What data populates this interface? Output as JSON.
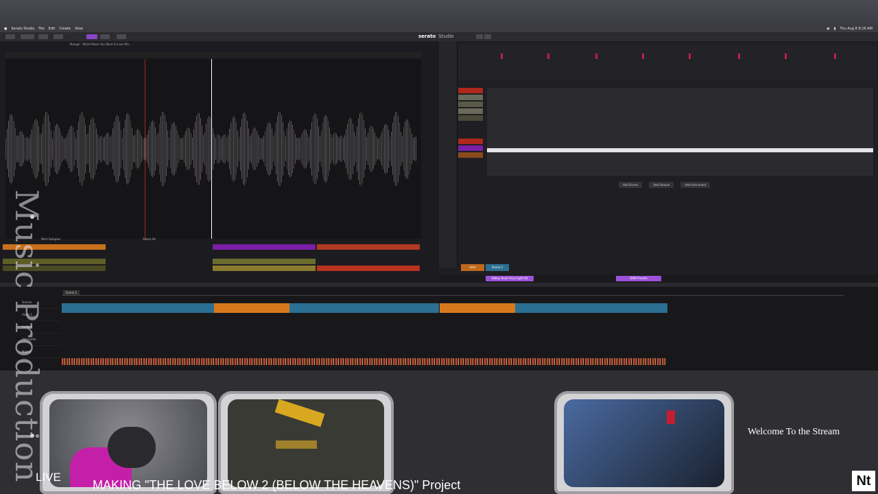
{
  "menubar": {
    "app_name": "Serato Studio",
    "items": [
      "File",
      "Edit",
      "Create",
      "View"
    ],
    "clock": "Thu Aug 8  8:16 AM"
  },
  "toolbar": {
    "logo": "serato",
    "logo_sub": "Studio"
  },
  "deck": {
    "track_info": "Mangai - What Makes You Want to Love Me..."
  },
  "pads": {
    "labels": [
      "Pitch Samples",
      "Select All"
    ]
  },
  "pattern": {
    "buttons": [
      "Add Drums",
      "Add Sample",
      "Add Instrument"
    ],
    "scenes": [
      "Intro",
      "Scene 2"
    ]
  },
  "selectors": {
    "kit": "Abbey Road Vinyl Light Kit",
    "preset": "DAW Presets"
  },
  "song": {
    "tracks": [
      "Scenes",
      "Audio 1",
      "Audio 2",
      "Add Audio",
      "Master"
    ],
    "scene_selector": "Scene 1"
  },
  "overlay": {
    "side_title": "Music Production",
    "live": "LIVE",
    "project_title": "MAKING \"THE LOVE BELOW 2 (BELOW THE HEAVENS)\" Project",
    "welcome": "Welcome To the Stream",
    "logo": "Nt"
  },
  "colors": {
    "accent_purple": "#9b52d8",
    "pad_orange": "#d87a1c",
    "pad_red": "#c0392b",
    "pad_olive": "#7a7a32",
    "clip_blue": "#2b6f93",
    "clip_orange": "#d8781c"
  }
}
